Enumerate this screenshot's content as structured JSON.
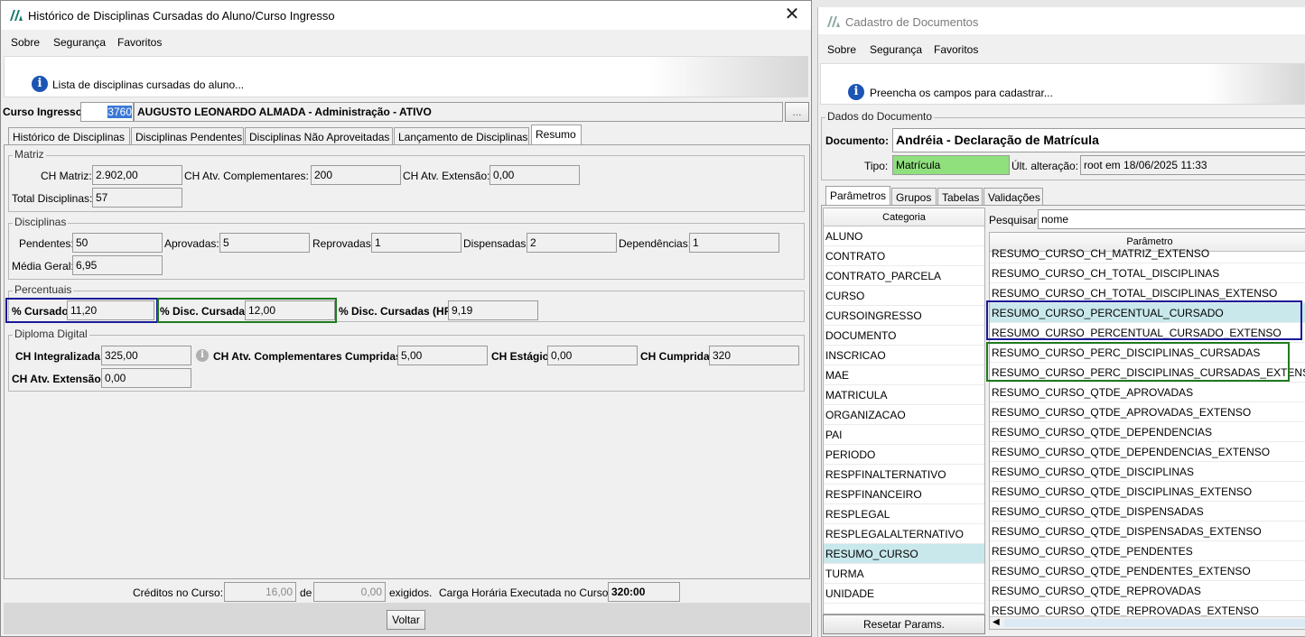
{
  "left_window": {
    "title": "Histórico de Disciplinas Cursadas do Aluno/Curso Ingresso",
    "menu": [
      "Sobre",
      "Segurança",
      "Favoritos"
    ],
    "info_text": "Lista de disciplinas cursadas do aluno...",
    "curso_ingresso_label": "Curso Ingresso:",
    "curso_code": "3760",
    "curso_desc": "AUGUSTO LEONARDO ALMADA - Administração - ATIVO",
    "lookup_button": "...",
    "tabs": [
      "Histórico de Disciplinas",
      "Disciplinas Pendentes",
      "Disciplinas Não Aproveitadas",
      "Lançamento de Disciplinas",
      "Resumo"
    ],
    "matriz": {
      "title": "Matriz",
      "ch_matriz_label": "CH Matriz:",
      "ch_matriz": "2.902,00",
      "ch_atv_comp_label": "CH Atv. Complementares:",
      "ch_atv_comp": "200",
      "ch_atv_ext_label": "CH Atv. Extensão:",
      "ch_atv_ext": "0,00",
      "total_disc_label": "Total Disciplinas:",
      "total_disc": "57"
    },
    "disciplinas": {
      "title": "Disciplinas",
      "pendentes_label": "Pendentes:",
      "pendentes": "50",
      "aprovadas_label": "Aprovadas:",
      "aprovadas": "5",
      "reprovadas_label": "Reprovadas:",
      "reprovadas": "1",
      "dispensadas_label": "Dispensadas:",
      "dispensadas": "2",
      "dependencias_label": "Dependências:",
      "dependencias": "1",
      "media_label": "Média Geral:",
      "media": "6,95"
    },
    "percentuais": {
      "title": "Percentuais",
      "cursado_label": "% Cursado:",
      "cursado": "11,20",
      "disc_cursadas_label": "% Disc. Cursadas:",
      "disc_cursadas": "12,00",
      "disc_cursadas_hr_label": "% Disc. Cursadas (HR):",
      "disc_cursadas_hr": "9,19"
    },
    "diploma": {
      "title": "Diploma Digital",
      "ch_integralizada_label": "CH Integralizada:",
      "ch_integralizada": "325,00",
      "ch_atv_comp_cumpridas_label": "CH Atv. Complementares Cumpridas:",
      "ch_atv_comp_cumpridas": "5,00",
      "ch_estagio_label": "CH Estágio:",
      "ch_estagio": "0,00",
      "ch_cumprida_label": "CH Cumprida:",
      "ch_cumprida": "320",
      "ch_atv_ext_label": "CH Atv. Extensão:",
      "ch_atv_ext": "0,00"
    },
    "footer": {
      "creditos_label": "Créditos no Curso:",
      "creditos": "16,00",
      "de_label": "de",
      "exigidos": "0,00",
      "exigidos_label": "exigidos.",
      "carga_label": "Carga Horária Executada no Curso:",
      "carga": "320:00"
    },
    "voltar_button": "Voltar"
  },
  "right_window": {
    "title": "Cadastro de Documentos",
    "menu": [
      "Sobre",
      "Segurança",
      "Favoritos"
    ],
    "info_text": "Preencha os campos para cadastrar...",
    "dados_title": "Dados do Documento",
    "documento_label": "Documento:",
    "documento": "Andréia - Declaração de Matrícula",
    "tipo_label": "Tipo:",
    "tipo": "Matrícula",
    "ult_alt_label": "Últ. alteração:",
    "ult_alt": "root em 18/06/2025 11:33",
    "tabs": [
      "Parâmetros",
      "Grupos",
      "Tabelas",
      "Validações"
    ],
    "categoria_header": "Categoria",
    "categories": [
      "ALUNO",
      "CONTRATO",
      "CONTRATO_PARCELA",
      "CURSO",
      "CURSOINGRESSO",
      "DOCUMENTO",
      "INSCRICAO",
      "MAE",
      "MATRICULA",
      "ORGANIZACAO",
      "PAI",
      "PERIODO",
      "RESPFINALTERNATIVO",
      "RESPFINANCEIRO",
      "RESPLEGAL",
      "RESPLEGALALTERNATIVO",
      "RESUMO_CURSO",
      "TURMA",
      "UNIDADE"
    ],
    "selected_category": "RESUMO_CURSO",
    "pesquisar_label": "Pesquisar:",
    "pesquisar_value": "nome",
    "parametro_header": "Parâmetro",
    "params": [
      "RESUMO_CURSO_CH_MATRIZ_EXTENSO",
      "RESUMO_CURSO_CH_TOTAL_DISCIPLINAS",
      "RESUMO_CURSO_CH_TOTAL_DISCIPLINAS_EXTENSO",
      "RESUMO_CURSO_PERCENTUAL_CURSADO",
      "RESUMO_CURSO_PERCENTUAL_CURSADO_EXTENSO",
      "RESUMO_CURSO_PERC_DISCIPLINAS_CURSADAS",
      "RESUMO_CURSO_PERC_DISCIPLINAS_CURSADAS_EXTENSO",
      "RESUMO_CURSO_QTDE_APROVADAS",
      "RESUMO_CURSO_QTDE_APROVADAS_EXTENSO",
      "RESUMO_CURSO_QTDE_DEPENDENCIAS",
      "RESUMO_CURSO_QTDE_DEPENDENCIAS_EXTENSO",
      "RESUMO_CURSO_QTDE_DISCIPLINAS",
      "RESUMO_CURSO_QTDE_DISCIPLINAS_EXTENSO",
      "RESUMO_CURSO_QTDE_DISPENSADAS",
      "RESUMO_CURSO_QTDE_DISPENSADAS_EXTENSO",
      "RESUMO_CURSO_QTDE_PENDENTES",
      "RESUMO_CURSO_QTDE_PENDENTES_EXTENSO",
      "RESUMO_CURSO_QTDE_REPROVADAS",
      "RESUMO_CURSO_QTDE_REPROVADAS_EXTENSO"
    ],
    "reset_button": "Resetar Params.",
    "colors": {
      "tipo_bg": "#90e07e",
      "selected_row": "#c8e8ec",
      "highlight_blue": "#1a1a9a",
      "highlight_green": "#1e7a1e"
    }
  }
}
